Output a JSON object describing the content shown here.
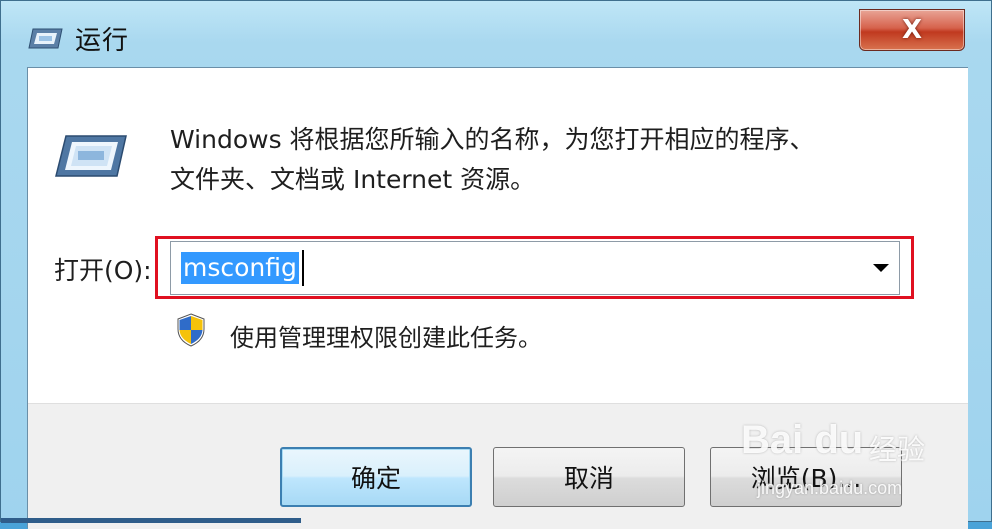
{
  "window": {
    "title": "运行",
    "close_label": "X"
  },
  "description": {
    "line1": "Windows 将根据您所输入的名称，为您打开相应的程序、",
    "line2": "文件夹、文档或 Internet 资源。"
  },
  "open_field": {
    "label": "打开(O):",
    "value": "msconfig"
  },
  "admin_note": "使用管理理权限创建此任务。",
  "buttons": {
    "ok": "确定",
    "cancel": "取消",
    "browse": "浏览(B)..."
  },
  "watermark": {
    "logo": "Bai du",
    "cn": "经验",
    "url": "jingyan.baidu.com"
  },
  "colors": {
    "highlight_border": "#e01020",
    "selection": "#3399ff",
    "close_button": "#c0391f"
  },
  "icons": [
    "run-app-icon",
    "uac-shield-icon",
    "dropdown-arrow-icon",
    "close-icon"
  ]
}
